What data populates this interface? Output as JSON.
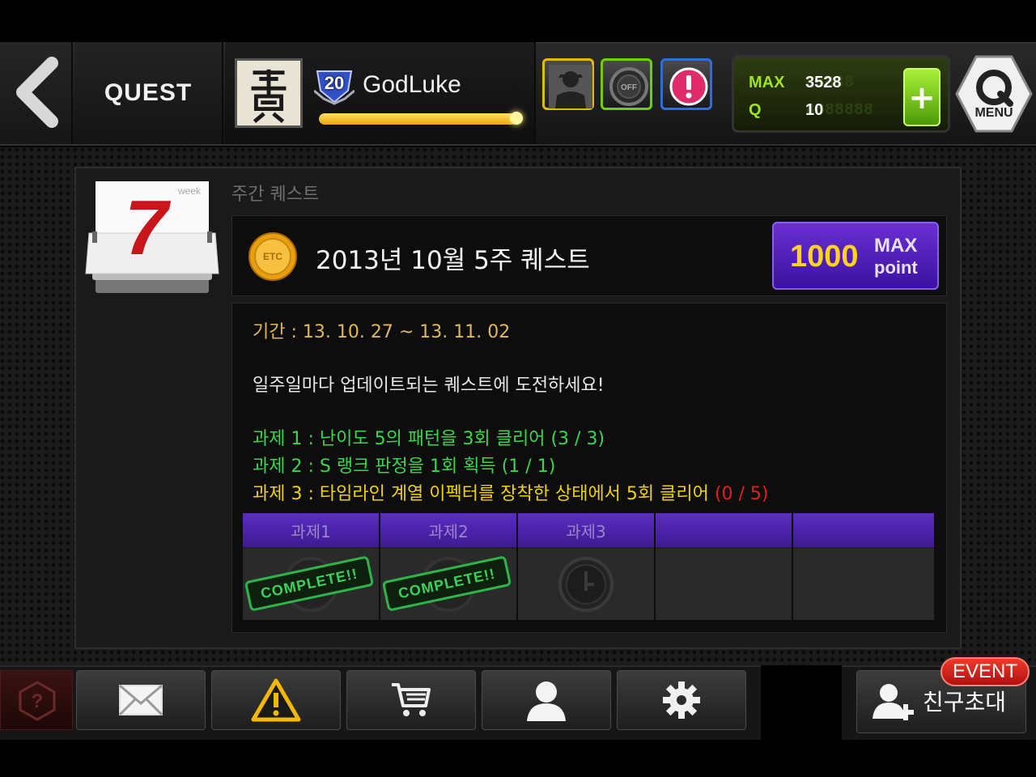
{
  "header": {
    "screen_title": "QUEST",
    "username": "GodLuke",
    "level": "20",
    "xp_progress": 0.97,
    "currency": {
      "max_label": "MAX",
      "max_value": "3528",
      "q_label": "Q",
      "q_value": "10"
    },
    "menu_label": "MENU",
    "off_label": "OFF",
    "plus_label": "+"
  },
  "quest": {
    "section_label": "주간 퀘스트",
    "calendar_week_label": "week",
    "calendar_number": "7",
    "coin_label": "ETC",
    "title": "2013년 10월 5주 퀘스트",
    "reward_amount": "1000",
    "reward_unit_top": "MAX",
    "reward_unit_bottom": "point",
    "period": "기간 : 13. 10. 27 ~ 13. 11. 02",
    "description": "일주일마다 업데이트되는 퀘스트에 도전하세요!",
    "tasks": [
      {
        "text": "과제 1 : 난이도 5의 패턴을 3회 클리어 (3 / 3)",
        "progress": "",
        "status": "complete",
        "color": "#37d94a"
      },
      {
        "text": "과제 2 : S 랭크 판정을 1회 획득 (1 / 1)",
        "progress": "",
        "status": "complete",
        "color": "#37d94a"
      },
      {
        "text": "과제 3 : 타임라인 계열 이펙터를 장착한 상태에서 5회 클리어 ",
        "progress": "(0 / 5)",
        "status": "incomplete",
        "color": "#f2d200"
      }
    ],
    "task_slots": [
      {
        "label": "과제1",
        "stamp": "COMPLETE!!"
      },
      {
        "label": "과제2",
        "stamp": "COMPLETE!!"
      },
      {
        "label": "과제3",
        "stamp": ""
      },
      {
        "label": "",
        "stamp": ""
      },
      {
        "label": "",
        "stamp": ""
      }
    ]
  },
  "footer": {
    "help_icon": "question-icon",
    "buttons": [
      "mail-icon",
      "warning-icon",
      "cart-icon",
      "profile-icon",
      "gear-icon"
    ],
    "event_badge": "EVENT",
    "invite_label": "친구초대"
  },
  "colors": {
    "accent_purple": "#5a2cc4",
    "xp_yellow": "#e8a800",
    "complete_green": "#37d94a",
    "period_gold": "#e0b85a",
    "incomplete_red": "#e02020"
  }
}
